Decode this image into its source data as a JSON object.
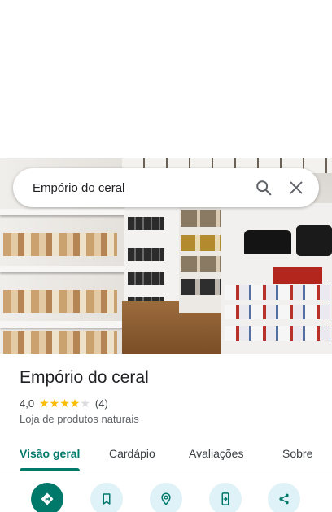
{
  "search": {
    "query": "Empório do ceral",
    "search_icon": "search-icon",
    "close_icon": "close-icon"
  },
  "place": {
    "name": "Empório do ceral",
    "rating": "4,0",
    "rating_fraction": 0.8,
    "review_count": "(4)",
    "category": "Loja de produtos naturais",
    "photo_description_icon": "store-photo"
  },
  "tabs": [
    {
      "label": "Visão geral",
      "active": true
    },
    {
      "label": "Cardápio",
      "active": false
    },
    {
      "label": "Avaliações",
      "active": false
    },
    {
      "label": "Sobre",
      "active": false
    }
  ],
  "actions": [
    {
      "name": "directions",
      "icon": "directions-icon"
    },
    {
      "name": "save",
      "icon": "bookmark-icon"
    },
    {
      "name": "nearby",
      "icon": "nearby-icon"
    },
    {
      "name": "send-to-phone",
      "icon": "send-to-phone-icon"
    },
    {
      "name": "share",
      "icon": "share-icon"
    }
  ],
  "colors": {
    "accent": "#00796b",
    "star": "#fbbc04",
    "action_bg": "#dff2f7"
  }
}
